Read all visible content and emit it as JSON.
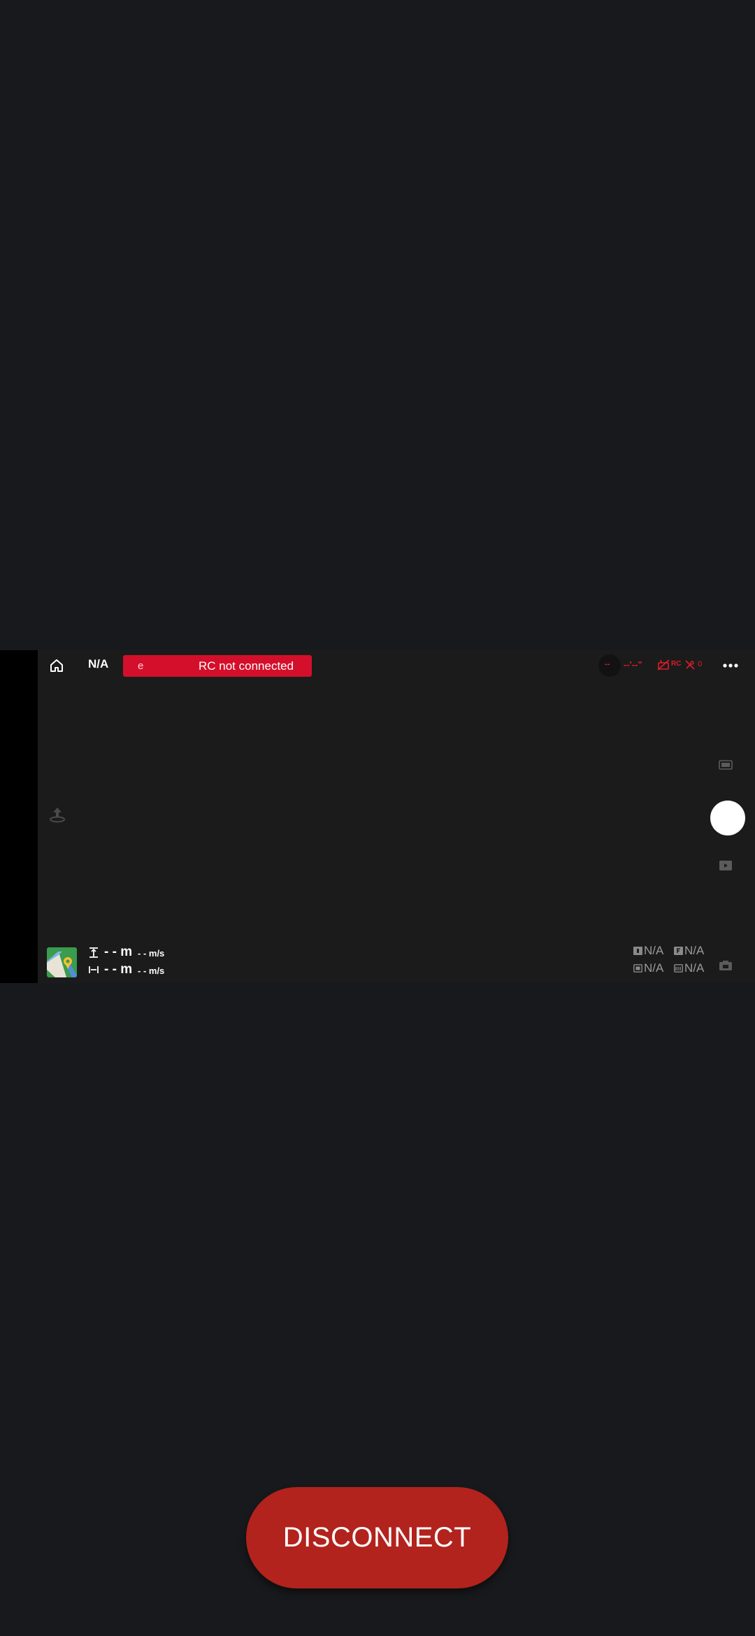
{
  "top_bar": {
    "flight_mode": "N/A",
    "status_prefix": "e",
    "status_message": "RC not connected",
    "gps_signal": "--",
    "signal_strength": "--'--\"",
    "rc_label": "RC",
    "satellite_count": "0"
  },
  "telemetry": {
    "altitude": "- - m",
    "vertical_speed": "- - m/s",
    "distance": "- - m",
    "horizontal_speed": "- - m/s"
  },
  "camera_params": {
    "iso": "N/A",
    "aperture": "N/A",
    "shutter": "N/A",
    "ev": "N/A"
  },
  "footer": {
    "disconnect_label": "DISCONNECT"
  },
  "colors": {
    "background": "#18191c",
    "panel": "#1b1b1b",
    "alert_red": "#d40f2b",
    "disconnect_red": "#b2231d"
  }
}
